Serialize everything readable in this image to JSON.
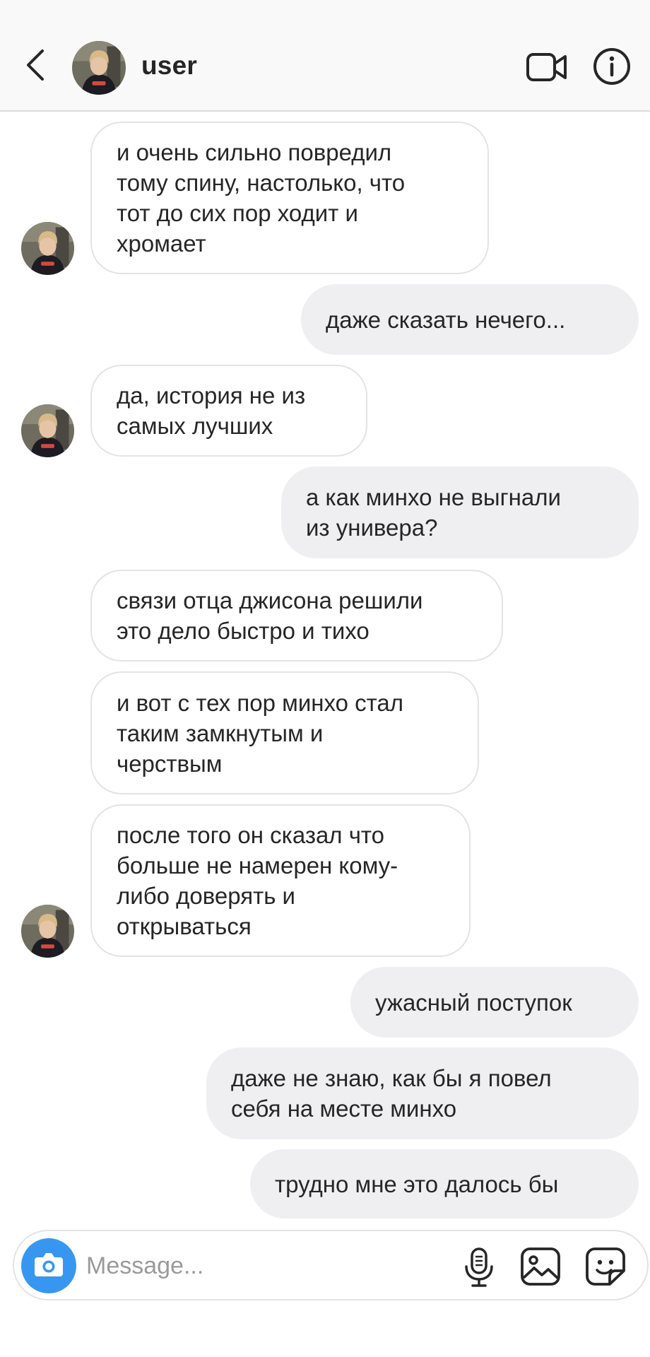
{
  "header": {
    "username": "user",
    "back_icon": "chevron-left-icon",
    "video_icon": "video-camera-icon",
    "info_icon": "info-icon"
  },
  "messages": [
    {
      "direction": "incoming",
      "text": "и очень сильно повредил\nтому спину, настолько, что\nтот до сих пор ходит и\nхромает",
      "show_avatar": true
    },
    {
      "direction": "outgoing",
      "text": "даже сказать нечего..."
    },
    {
      "direction": "incoming",
      "text": "да, история не из\nсамых лучших",
      "show_avatar": true
    },
    {
      "direction": "outgoing",
      "text": "а как минхо не выгнали\nиз универа?"
    },
    {
      "direction": "incoming",
      "text": "связи отца джисона решили\nэто дело быстро и тихо",
      "show_avatar": false
    },
    {
      "direction": "incoming",
      "text": "и вот с тех пор минхо стал\nтаким замкнутым и\nчерствым",
      "show_avatar": false
    },
    {
      "direction": "incoming",
      "text": "после того он сказал что\nбольше не намерен кому-\nлибо доверять и\nоткрываться",
      "show_avatar": true
    },
    {
      "direction": "outgoing",
      "text": "ужасный поступок"
    },
    {
      "direction": "outgoing",
      "text": "даже не знаю, как бы я повел\nсебя на месте минхо"
    },
    {
      "direction": "outgoing",
      "text": "трудно мне это далось бы"
    }
  ],
  "composer": {
    "placeholder": "Message...",
    "camera_icon": "camera-icon",
    "mic_icon": "microphone-icon",
    "gallery_icon": "gallery-icon",
    "sticker_icon": "sticker-icon"
  },
  "colors": {
    "accent": "#3797f0",
    "outgoing_bubble": "#efeff1",
    "incoming_border": "#e3e3e3",
    "text": "#262626"
  }
}
